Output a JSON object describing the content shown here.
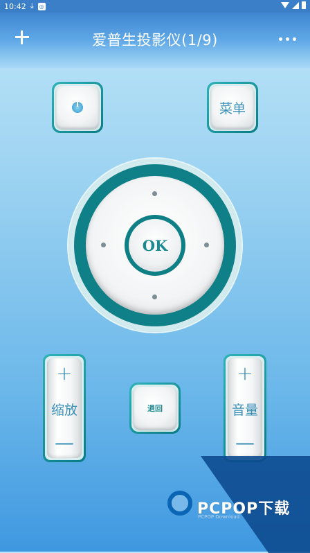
{
  "status_bar": {
    "time": "10:42"
  },
  "header": {
    "title": "爱普生投影仪(1/9)"
  },
  "buttons": {
    "menu_label": "菜单",
    "ok_label": "OK",
    "back_label": "退回"
  },
  "zoom": {
    "plus": "+",
    "label": "缩放",
    "minus": "—"
  },
  "volume": {
    "plus": "+",
    "label": "音量",
    "minus": "—"
  },
  "watermark": {
    "brand": "PCPOP下载",
    "sub": "PCPOP Download"
  },
  "colors": {
    "accent": "#0f8088",
    "header": "#3f86d2",
    "icon_text": "#3a8fb7"
  }
}
